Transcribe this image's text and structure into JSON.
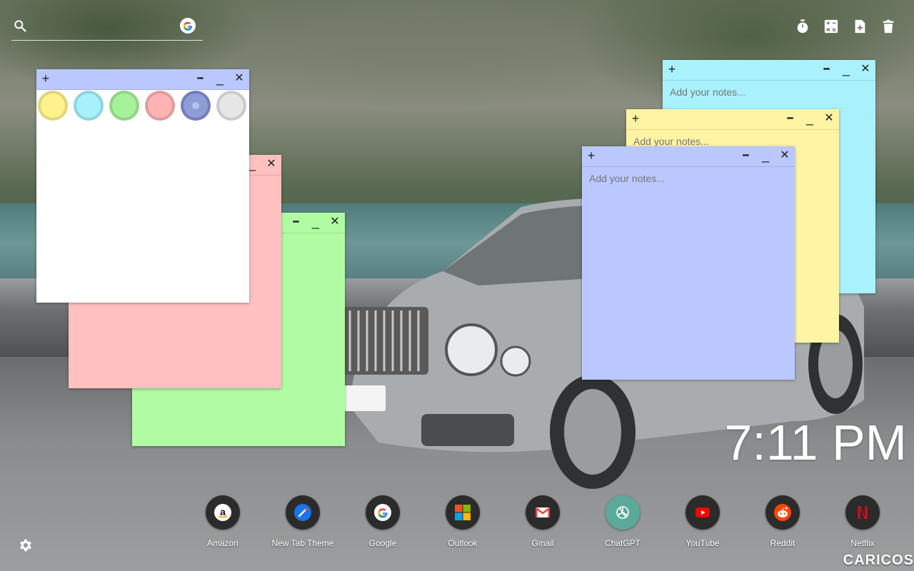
{
  "search": {
    "placeholder": ""
  },
  "toolbar": {
    "icons": [
      "timer-icon",
      "calculator-icon",
      "add-note-icon",
      "trash-icon"
    ]
  },
  "notes": [
    {
      "id": "white",
      "color": "#ffffff",
      "placeholder": "",
      "show_palette": true
    },
    {
      "id": "pink",
      "color": "#ffc0c0",
      "placeholder": ""
    },
    {
      "id": "green",
      "color": "#b1fca3",
      "placeholder": ""
    },
    {
      "id": "cyan",
      "color": "#a9f2fd",
      "placeholder": "Add your notes..."
    },
    {
      "id": "yellow",
      "color": "#fff4a3",
      "placeholder": "Add your notes..."
    },
    {
      "id": "blue",
      "color": "#bac8ff",
      "placeholder": "Add your notes..."
    }
  ],
  "note_controls": {
    "add": "+",
    "more": "•••",
    "minimize": "_",
    "close": "✕"
  },
  "palette": [
    "#fff28c",
    "#a6f1fc",
    "#a6f29a",
    "#ffb3b3",
    "#8f9dd6",
    "#e6e6e6"
  ],
  "clock": {
    "time": "7:11 PM"
  },
  "dock": [
    {
      "label": "Amazon",
      "icon": "amazon-icon"
    },
    {
      "label": "New Tab Theme",
      "icon": "new-tab-theme-icon"
    },
    {
      "label": "Google",
      "icon": "google-icon"
    },
    {
      "label": "Outlook",
      "icon": "outlook-icon"
    },
    {
      "label": "Gmail",
      "icon": "gmail-icon"
    },
    {
      "label": "ChatGPT",
      "icon": "chatgpt-icon"
    },
    {
      "label": "YouTube",
      "icon": "youtube-icon"
    },
    {
      "label": "Reddit",
      "icon": "reddit-icon"
    },
    {
      "label": "Netflix",
      "icon": "netflix-icon"
    }
  ],
  "watermark": "CARICOS"
}
